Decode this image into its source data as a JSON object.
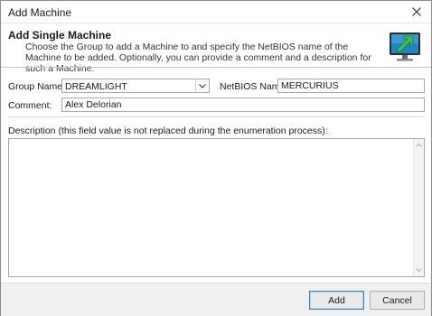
{
  "window": {
    "title": "Add Machine"
  },
  "header": {
    "title": "Add Single Machine",
    "description": "Choose the Group to add a Machine to and specify the NetBIOS name of the Machine to be added. Optionally, you can provide a comment and a description for such a Machine.",
    "icon": "monitor-add-icon"
  },
  "form": {
    "group_label": "Group Name:",
    "group_value": "DREAMLIGHT",
    "netbios_label": "NetBIOS Name:",
    "netbios_value": "MERCURIUS",
    "comment_label": "Comment:",
    "comment_value": "Alex Delorian",
    "description_label": "Description (this field value is not replaced during the enumeration process):",
    "description_value": ""
  },
  "footer": {
    "add_label": "Add",
    "cancel_label": "Cancel"
  },
  "colors": {
    "accent_border": "#3c7fb1",
    "icon_green": "#3cc34a",
    "icon_screen": "#1e86c8"
  }
}
